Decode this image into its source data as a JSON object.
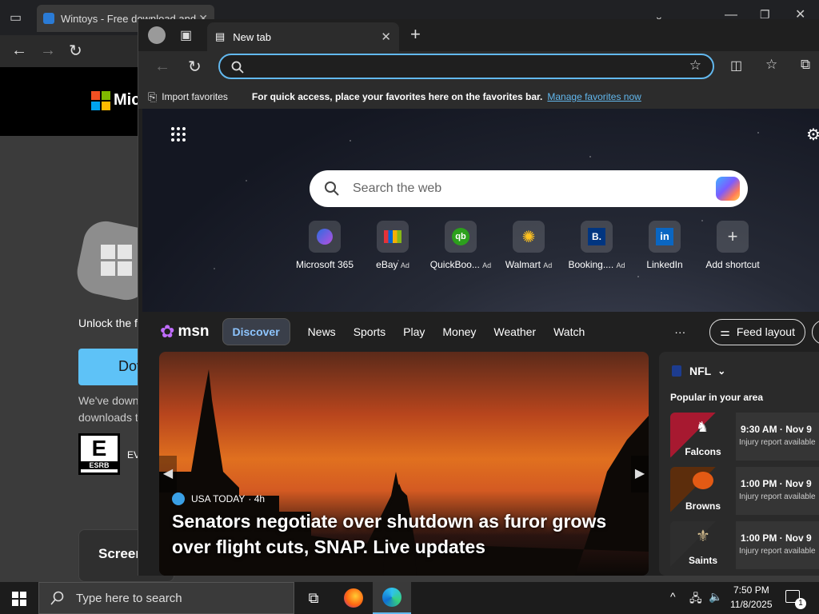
{
  "bg_browser": {
    "tab_title": "Wintoys - Free download and",
    "brand_text": "Mic",
    "unlock_text": "Unlock the f",
    "download_btn": "Dov",
    "downloads_line1": "We've down",
    "downloads_line2": "downloads t",
    "esrb_label": "ESRB",
    "esrb_rating": "E",
    "esrb_text": "EV",
    "screen_card": "Screer"
  },
  "edge": {
    "tab_title": "New tab",
    "address_value": "",
    "favorites_bar": {
      "import_label": "Import favorites",
      "hint": "For quick access, place your favorites here on the favorites bar.",
      "manage_link": "Manage favorites now"
    },
    "search_placeholder": "Search the web",
    "shortcuts": [
      {
        "label": "Microsoft 365",
        "ad": ""
      },
      {
        "label": "eBay",
        "ad": "Ad"
      },
      {
        "label": "QuickBoo...",
        "ad": "Ad"
      },
      {
        "label": "Walmart",
        "ad": "Ad"
      },
      {
        "label": "Booking....",
        "ad": "Ad"
      },
      {
        "label": "LinkedIn",
        "ad": ""
      },
      {
        "label": "Add shortcut",
        "ad": ""
      }
    ],
    "msn": {
      "logo_text": "msn",
      "nav": [
        "Discover",
        "News",
        "Sports",
        "Play",
        "Money",
        "Weather",
        "Watch"
      ],
      "more": "···",
      "feed_layout": "Feed layout"
    },
    "hero": {
      "source": "USA TODAY",
      "age": "· 4h",
      "headline": "Senators negotiate over shutdown as furor grows over flight cuts, SNAP. Live updates"
    },
    "nfl": {
      "title": "NFL",
      "subtitle": "Popular in your area",
      "games": [
        {
          "team": "Falcons",
          "time": "9:30 AM · Nov 9",
          "note": "Injury report available"
        },
        {
          "team": "Browns",
          "time": "1:00 PM · Nov 9",
          "note": "Injury report available"
        },
        {
          "team": "Saints",
          "time": "1:00 PM · Nov 9",
          "note": "Injury report available"
        }
      ]
    }
  },
  "taskbar": {
    "search_placeholder": "Type here to search",
    "time": "7:50 PM",
    "date": "11/8/2025",
    "notification_count": "1"
  },
  "colors": {
    "accent_blue": "#62b8ee",
    "link_blue": "#62b8ee",
    "discover_bg": "#3a3f4a"
  }
}
